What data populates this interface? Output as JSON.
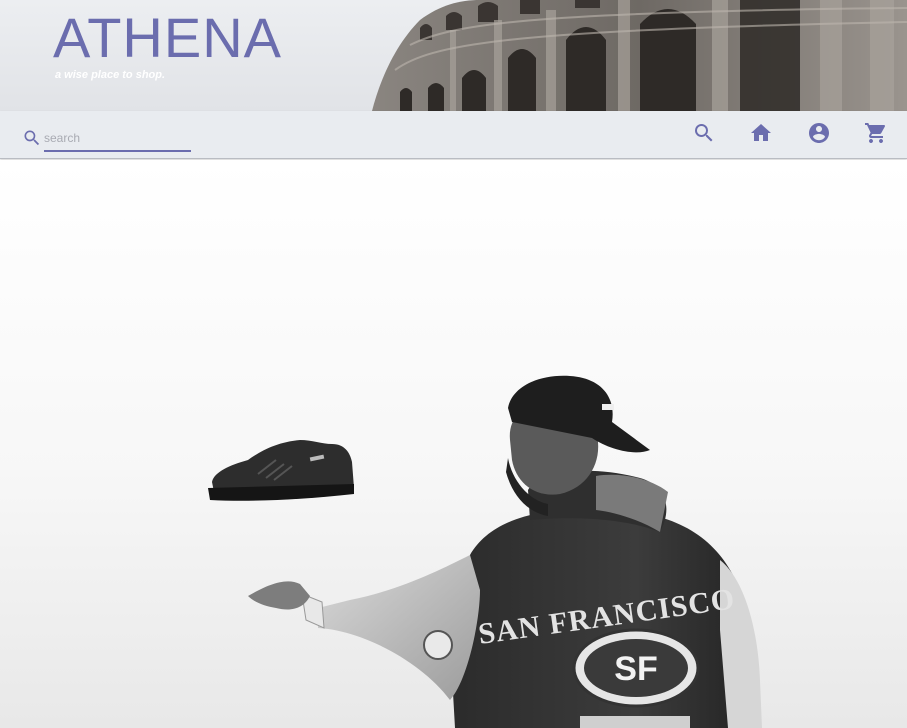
{
  "header": {
    "brand": "ATHENA",
    "tagline": "a wise place to shop."
  },
  "toolbar": {
    "search_placeholder": "search",
    "search_value": "",
    "icons": [
      "search-icon",
      "home-icon",
      "account-icon",
      "cart-icon"
    ]
  },
  "hero": {
    "jacket_text": "SAN FRANCISCO",
    "logo_text": "SF"
  },
  "colors": {
    "accent": "#6b6dae",
    "toolbar_bg": "#e9ecf0",
    "banner_bg": "#e6e8ec"
  }
}
